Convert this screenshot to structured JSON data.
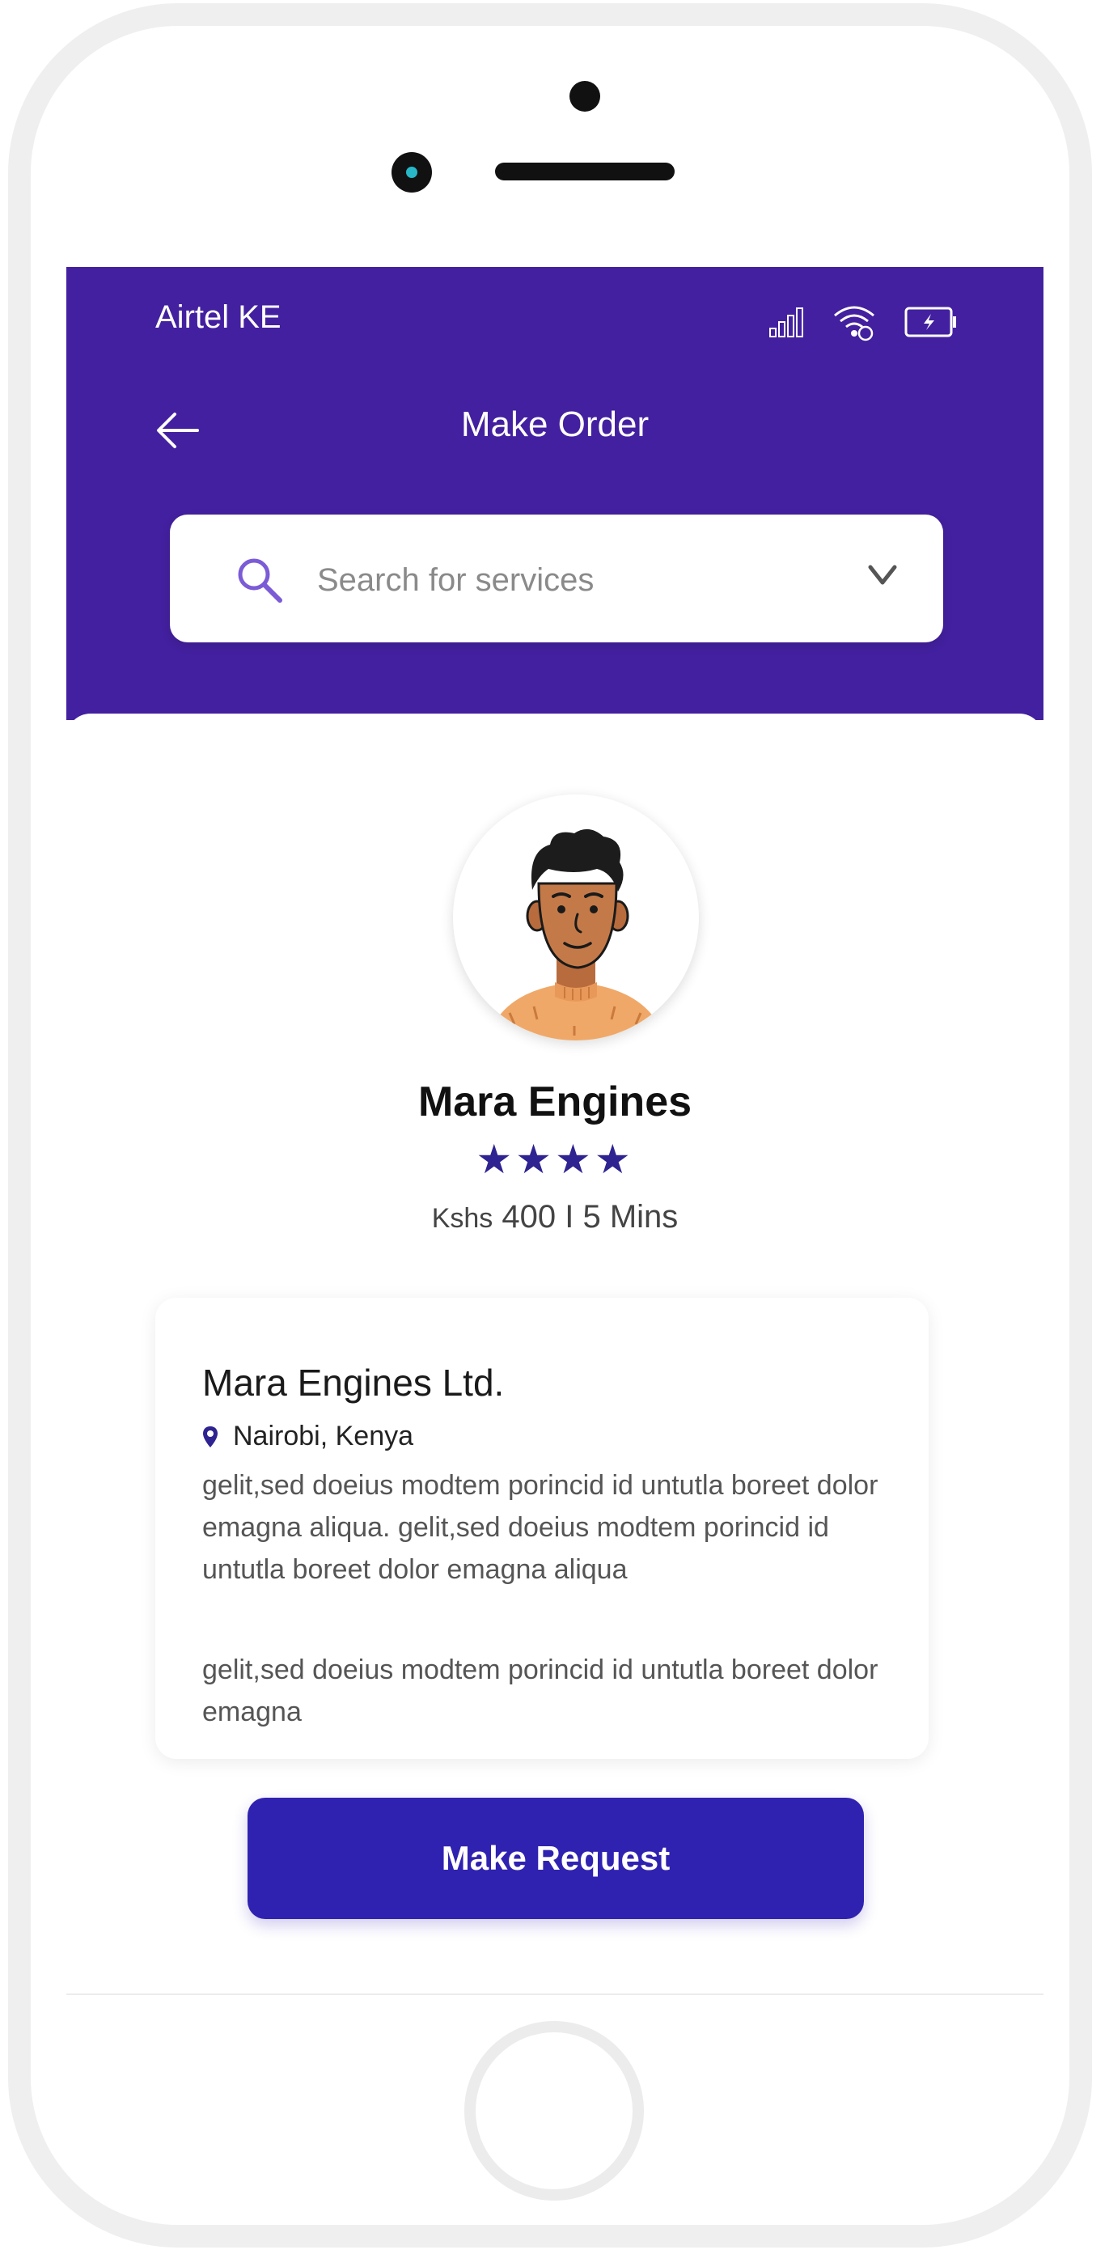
{
  "status_bar": {
    "carrier": "Airtel KE",
    "icons": [
      "signal-icon",
      "wifi-icon",
      "battery-icon"
    ]
  },
  "header": {
    "title": "Make Order",
    "back_icon": "back-arrow-icon"
  },
  "search": {
    "placeholder": "Search for services",
    "icon": "search-icon",
    "dropdown_icon": "chevron-down-icon"
  },
  "provider": {
    "name": "Mara Engines",
    "rating_stars": 4,
    "stars_text": "★★★★",
    "price_unit": "Kshs",
    "price_details": "400 I 5 Mins"
  },
  "details_card": {
    "title": "Mara Engines Ltd.",
    "location": "Nairobi, Kenya",
    "description": "gelit,sed doeius modtem porincid id untutla boreet dolor emagna aliqua. gelit,sed doeius modtem porincid id untutla boreet dolor emagna aliqua",
    "description_2": "gelit,sed doeius modtem porincid id untutla boreet dolor emagna"
  },
  "actions": {
    "make_request_label": "Make Request"
  },
  "colors": {
    "header_bg": "#43209f",
    "button_bg": "#3022b0",
    "star": "#2e2390",
    "accent_icon": "#7b5bd6"
  }
}
